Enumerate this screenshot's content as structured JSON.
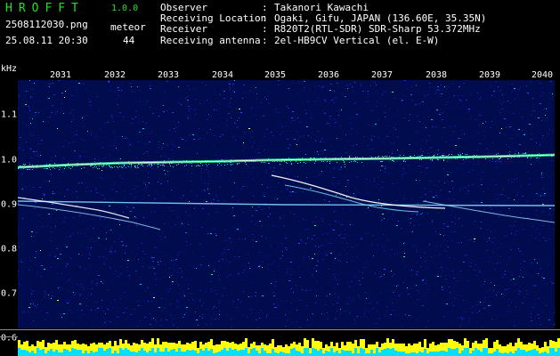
{
  "header": {
    "app_name": "HROFFT",
    "app_version": "1.0.0",
    "file_name": "2508112030.png",
    "timestamp": "25.08.11 20:30",
    "meteor_label": "meteor",
    "meteor_count": "44"
  },
  "info": [
    {
      "key": "Observer",
      "sep": ":",
      "value": "Takanori Kawachi"
    },
    {
      "key": "Receiving Location",
      "sep": ":",
      "value": "Ogaki, Gifu, JAPAN (136.60E, 35.35N)"
    },
    {
      "key": "Receiver",
      "sep": ":",
      "value": "R820T2(RTL-SDR) SDR-Sharp 53.372MHz"
    },
    {
      "key": "Receiving antenna",
      "sep": ":",
      "value": "2el-HB9CV Vertical (el. E-W)"
    }
  ],
  "spectrogram": {
    "unit_label": "kHz",
    "minute_labels": [
      "2031",
      "2032",
      "2033",
      "2034",
      "2035",
      "2036",
      "2037",
      "2038",
      "2039",
      "2040"
    ],
    "freq_labels": [
      "1.1",
      "1.0",
      "0.9",
      "0.8",
      "0.7",
      "0.6"
    ],
    "colors": {
      "background": "#000c4e",
      "noise": [
        "#0a1a9a",
        "#1030d0",
        "#2058ff",
        "#00c0ff",
        "#20ff80",
        "#ffff40"
      ],
      "trace": "#ffffff"
    }
  },
  "strip": {
    "colors": {
      "yellow": "#ffff00",
      "cyan": "#00e0ff"
    }
  }
}
